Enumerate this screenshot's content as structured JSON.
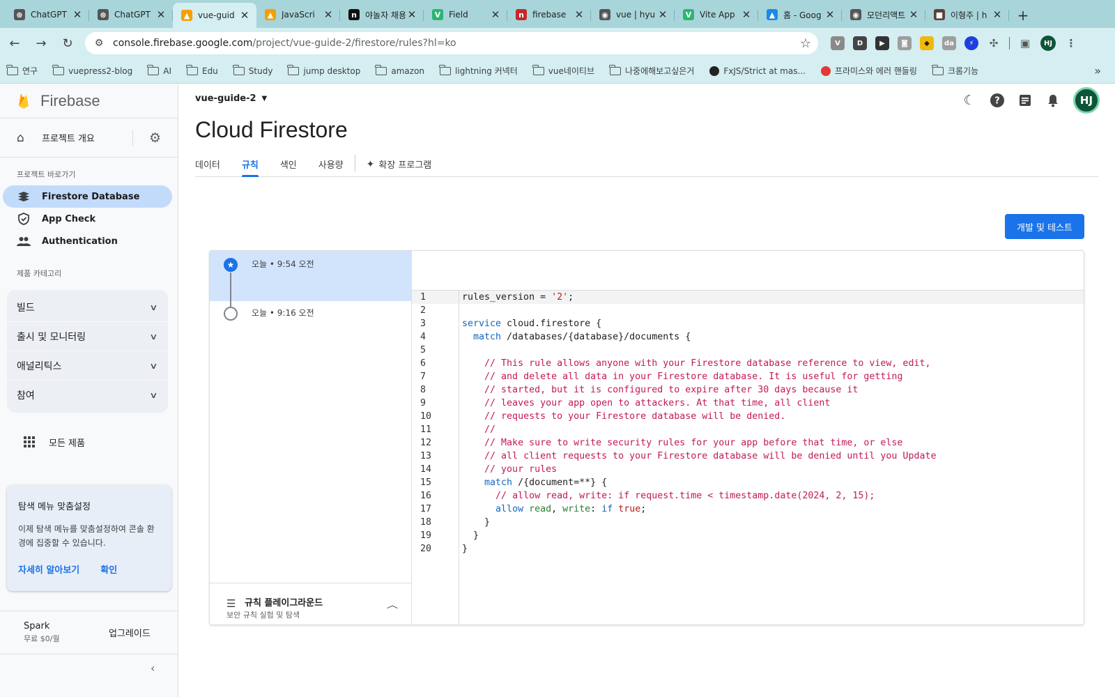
{
  "browser": {
    "tabs": [
      {
        "title": "ChatGPT",
        "fav": "⊛",
        "color": "#555555"
      },
      {
        "title": "ChatGPT",
        "fav": "⊛",
        "color": "#555555"
      },
      {
        "title": "vue-guid",
        "fav": "▲",
        "color": "#f6a000",
        "active": true
      },
      {
        "title": "JavaScri",
        "fav": "▲",
        "color": "#f6a000"
      },
      {
        "title": "야놀자 채용",
        "fav": "n",
        "color": "#111111"
      },
      {
        "title": "Field",
        "fav": "V",
        "color": "#2bb673"
      },
      {
        "title": "firebase",
        "fav": "n",
        "color": "#c62828"
      },
      {
        "title": "vue | hyu",
        "fav": "◉",
        "color": "#555555"
      },
      {
        "title": "Vite App",
        "fav": "V",
        "color": "#2bb673"
      },
      {
        "title": "홈 - Goog",
        "fav": "▲",
        "color": "#1e88e5"
      },
      {
        "title": "모던리액트",
        "fav": "◉",
        "color": "#555555"
      },
      {
        "title": "이형주 | h",
        "fav": "■",
        "color": "#5d4037"
      }
    ],
    "close_glyph": "✕",
    "new_tab_glyph": "+",
    "url_host": "console.firebase.google.com",
    "url_path": "/project/vue-guide-2/firestore/rules?hl=ko",
    "profile_initials": "HJ",
    "bookmarks": [
      {
        "label": "연구",
        "type": "folder"
      },
      {
        "label": "vuepress2-blog",
        "type": "folder"
      },
      {
        "label": "AI",
        "type": "folder"
      },
      {
        "label": "Edu",
        "type": "folder"
      },
      {
        "label": "Study",
        "type": "folder"
      },
      {
        "label": "jump desktop",
        "type": "folder"
      },
      {
        "label": "amazon",
        "type": "folder"
      },
      {
        "label": "lightning 커넥터",
        "type": "folder"
      },
      {
        "label": "vue네이티브",
        "type": "folder"
      },
      {
        "label": "나중에해보고싶은거",
        "type": "folder"
      },
      {
        "label": "FxJS/Strict at mas...",
        "type": "github"
      },
      {
        "label": "프라미스와 에러 핸들링",
        "type": "site"
      },
      {
        "label": "크롬기능",
        "type": "folder"
      }
    ],
    "bookmarks_more": "»"
  },
  "sidebar": {
    "brand": "Firebase",
    "overview_label": "프로젝트 개요",
    "shortcuts_label": "프로젝트 바로가기",
    "shortcuts": [
      {
        "label": "Firestore Database",
        "icon": "firestore-icon",
        "active": true
      },
      {
        "label": "App Check",
        "icon": "shield-icon"
      },
      {
        "label": "Authentication",
        "icon": "people-icon"
      }
    ],
    "categories_label": "제품 카테고리",
    "categories": [
      "빌드",
      "출시 및 모니터링",
      "애널리틱스",
      "참여"
    ],
    "all_products": "모든 제품",
    "promo": {
      "title": "탐색 메뉴 맞춤설정",
      "body": "이제 탐색 메뉴를 맞춤설정하여 콘솔 환경에 집중할 수 있습니다.",
      "learn_more": "자세히 알아보기",
      "confirm": "확인"
    },
    "plan": {
      "name": "Spark",
      "price": "무료 $0/월",
      "upgrade": "업그레이드"
    }
  },
  "header": {
    "project": "vue-guide-2",
    "avatar_initials": "HJ"
  },
  "page": {
    "title": "Cloud Firestore",
    "tabs": [
      "데이터",
      "규칙",
      "색인",
      "사용량"
    ],
    "active_tab": "규칙",
    "extensions_tab": "확장 프로그램",
    "primary_button": "개발 및 테스트"
  },
  "history": [
    {
      "time": "오늘 • 9:54 오전",
      "selected": true
    },
    {
      "time": "오늘 • 9:16 오전",
      "selected": false
    }
  ],
  "playground": {
    "title": "규칙 플레이그라운드",
    "subtitle": "보안 규칙 실험 및 탐색"
  },
  "editor": {
    "current_line": 1,
    "lines": [
      "rules_version = '2';",
      "",
      "service cloud.firestore {",
      "  match /databases/{database}/documents {",
      "",
      "    // This rule allows anyone with your Firestore database reference to view, edit,",
      "    // and delete all data in your Firestore database. It is useful for getting",
      "    // started, but it is configured to expire after 30 days because it",
      "    // leaves your app open to attackers. At that time, all client",
      "    // requests to your Firestore database will be denied.",
      "    //",
      "    // Make sure to write security rules for your app before that time, or else",
      "    // all client requests to your Firestore database will be denied until you Update",
      "    // your rules",
      "    match /{document=**} {",
      "      // allow read, write: if request.time < timestamp.date(2024, 2, 15);",
      "      allow read, write: if true;",
      "    }",
      "  }",
      "}"
    ]
  }
}
